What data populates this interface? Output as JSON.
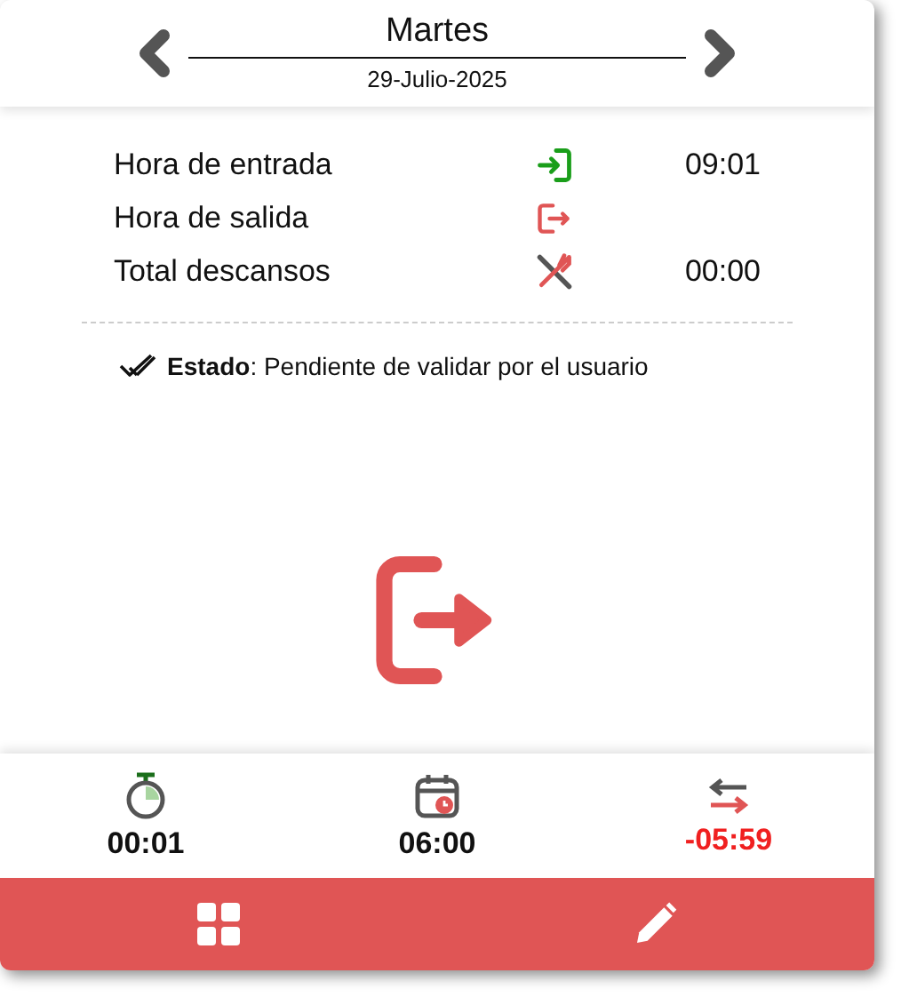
{
  "header": {
    "day": "Martes",
    "date": "29-Julio-2025"
  },
  "rows": [
    {
      "label": "Hora de entrada",
      "kind": "entry",
      "value": "09:01"
    },
    {
      "label": "Hora de salida",
      "kind": "exit"
    },
    {
      "label": "Total descansos",
      "kind": "break",
      "value": "00:00"
    }
  ],
  "status": {
    "text": "**Estado**: Pendiente de validar por el usuario"
  },
  "main_action": {
    "kind": "exit"
  },
  "stats": [
    {
      "kind": "timer",
      "value": "00:01",
      "negative": false
    },
    {
      "kind": "schedule",
      "value": "06:00",
      "negative": false
    },
    {
      "kind": "balance",
      "value": "-05:59",
      "negative": true
    }
  ],
  "toolbar": [
    {
      "kind": "grid"
    },
    {
      "kind": "edit"
    }
  ]
}
